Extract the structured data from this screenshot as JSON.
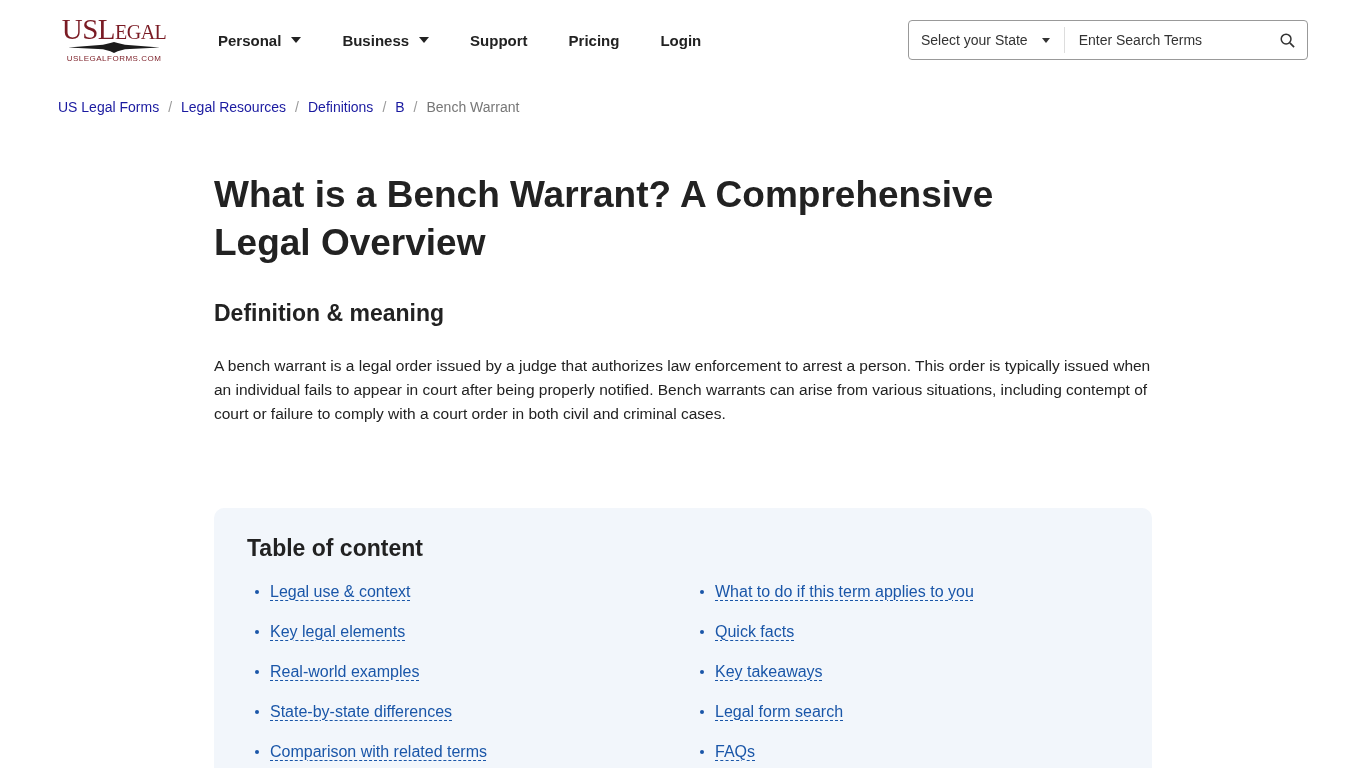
{
  "logo": {
    "wordmark": "USLegal",
    "domain": "USLEGALFORMS.COM"
  },
  "nav": [
    {
      "label": "Personal",
      "dropdown": true
    },
    {
      "label": "Business",
      "dropdown": true
    },
    {
      "label": "Support",
      "dropdown": false
    },
    {
      "label": "Pricing",
      "dropdown": false
    },
    {
      "label": "Login",
      "dropdown": false
    }
  ],
  "search": {
    "state_select": "Select your State",
    "placeholder": "Enter Search Terms"
  },
  "breadcrumbs": [
    {
      "label": "US Legal Forms",
      "current": false
    },
    {
      "separator": "/",
      "label": "Legal Resources",
      "current": false
    },
    {
      "separator": "/",
      "label": "Definitions",
      "current": false
    },
    {
      "separator": "/",
      "label": "B",
      "current": false
    },
    {
      "separator": "/",
      "label": "Bench Warrant",
      "current": true
    }
  ],
  "title": "What is a Bench Warrant? A Comprehensive Legal Overview",
  "subtitle": "Definition & meaning",
  "paragraph": "A bench warrant is a legal order issued by a judge that authorizes law enforcement to arrest a person. This order is typically issued when an individual fails to appear in court after being properly notified. Bench warrants can arise from various situations, including contempt of court or failure to comply with a court order in both civil and criminal cases.",
  "toc": {
    "heading": "Table of content",
    "links": [
      "Legal use & context",
      "What to do if this term applies to you",
      "Key legal elements",
      "Quick facts",
      "Real-world examples",
      "Key takeaways",
      "State-by-state differences",
      "Legal form search",
      "Comparison with related terms",
      "FAQs"
    ]
  }
}
